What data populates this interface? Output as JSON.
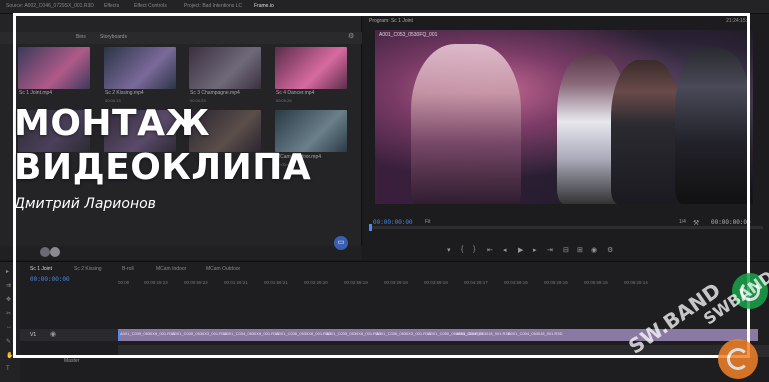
{
  "top_tabs": [
    "Source: A002_C046_0729SX_001.R3D",
    "Effects",
    "Effect Controls",
    "Project: Bad Intentions LC",
    "Frame.io"
  ],
  "project": {
    "tabs": [
      "Bins",
      "Storyboards"
    ],
    "clips": [
      {
        "name": "Sc 1 Joint.mp4",
        "duration": "",
        "c1": "#3a3a5a",
        "c2": "#b05a8a"
      },
      {
        "name": "Sc 2 Kissing.mp4",
        "duration": "00:00:13",
        "c1": "#2c3447",
        "c2": "#7a6a9a"
      },
      {
        "name": "Sc 3 Champagne.mp4",
        "duration": "00:00:23",
        "c1": "#3b2f3f",
        "c2": "#6f6a7a"
      },
      {
        "name": "Sc 4 Dancer.mp4",
        "duration": "00:00:26",
        "c1": "#5a2d4a",
        "c2": "#d86aa0"
      },
      {
        "name": "",
        "duration": "",
        "c1": "#2b2b33",
        "c2": "#4b3f5a"
      },
      {
        "name": "",
        "duration": "",
        "c1": "#2f2a35",
        "c2": "#5a4a6a"
      },
      {
        "name": "",
        "duration": "",
        "c1": "#2a2530",
        "c2": "#5b4e4a"
      },
      {
        "name": "MCam Outdoor.mp4",
        "duration": "00:00:40",
        "c1": "#2a3a45",
        "c2": "#6a7f8a"
      }
    ]
  },
  "program": {
    "title": "Program: Sc 1 Joint",
    "clip_name": "A001_C053_0530FQ_001",
    "timecode_top": "21:24:15:",
    "timecode_current": "00:00:00:00",
    "fit": "Fit",
    "zoom": "1/4",
    "duration": "00:00:00:00"
  },
  "timeline": {
    "sequence_tabs": [
      "Sc 1 Joint",
      "Sc 2 Kissing",
      "B-roll",
      "MCam Indoor",
      "MCam Outdoor"
    ],
    "timecode": "00:00:00:00",
    "ruler": [
      "00:00",
      "00:00:29:23",
      "00:00:59:22",
      "00:01:29:21",
      "00:01:59:21",
      "00:02:29:20",
      "00:02:59:19",
      "00:03:29:18",
      "00:03:59:18",
      "00:04:29:17",
      "00:04:59:16",
      "00:05:29:16",
      "00:05:59:15",
      "00:06:29:14"
    ],
    "track_label": "V1",
    "clips": [
      "A001_C039_0530X8_001.R3D",
      "A001_C035_0530X3_001.R3D",
      "A001_C034_0530X8_001.R3D",
      "A001_C036_0530X8_001.R3D",
      "A001_C035_0530X8_001.R3D",
      "A001_C036_0530X3_001.R3D",
      "A001_C050_0530X8_001.R3D",
      "A001_C060_0530J8_001.R3D",
      "A001_C004_0530J8_001.R3D"
    ],
    "master_label": "Master"
  },
  "overlay": {
    "title_line1": "МОНТАЖ",
    "title_line2": "ВИДЕОКЛИПА",
    "author": "Дмитрий Ларионов"
  },
  "watermark": {
    "text1": "SW.BAND",
    "text2": "SWBAND"
  },
  "colors": {
    "accent_blue": "#4a8cf2",
    "clip_purple": "#8a7aa3",
    "frame_white": "#ffffff",
    "watermark_green": "#17a34a",
    "watermark_orange": "#f2822a"
  }
}
